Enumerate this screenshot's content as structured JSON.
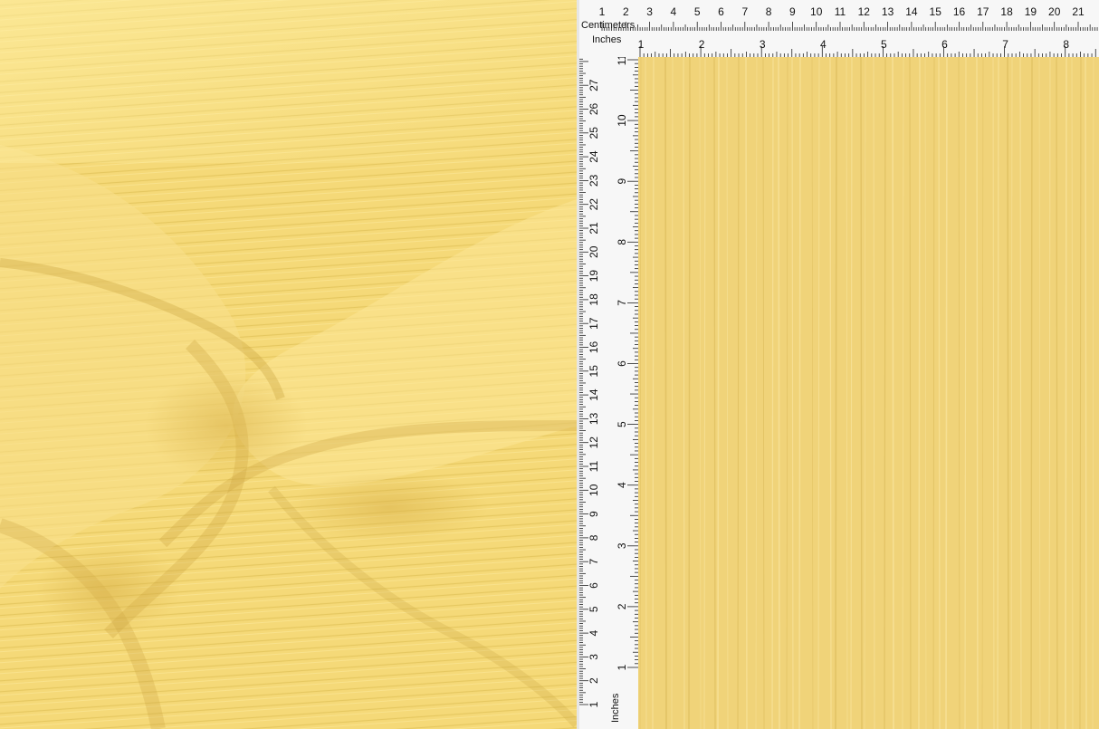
{
  "ruler": {
    "cm_label": "Centimeters",
    "in_label": "Inches",
    "top_cm_numbers": [
      "1",
      "2",
      "3",
      "4",
      "5",
      "6",
      "7",
      "8",
      "9",
      "10",
      "11",
      "12",
      "13",
      "14",
      "15",
      "16",
      "17",
      "18",
      "19",
      "20",
      "21"
    ],
    "top_in_numbers": [
      "1",
      "2",
      "3",
      "4",
      "5",
      "6",
      "7",
      "8"
    ],
    "left_cm_numbers": [
      "1",
      "2",
      "3",
      "4",
      "5",
      "6",
      "7",
      "8",
      "9",
      "10",
      "11",
      "12",
      "13",
      "14",
      "15",
      "16",
      "17",
      "18",
      "19",
      "20",
      "21",
      "22",
      "23",
      "24",
      "25",
      "26",
      "27"
    ],
    "left_in_numbers": [
      "1",
      "2",
      "3",
      "4",
      "5",
      "6",
      "7",
      "8",
      "9",
      "10",
      "11"
    ]
  },
  "colors": {
    "fabric": "#f3d877",
    "fabric_flat": "#f0d379",
    "ruler_bg": "#f7f7f7",
    "ink": "#111111"
  },
  "fabric": {
    "draped_photo": "draped yellow ribbed fabric",
    "flat_photo": "flat yellow ribbed fabric with vertical ribs"
  }
}
